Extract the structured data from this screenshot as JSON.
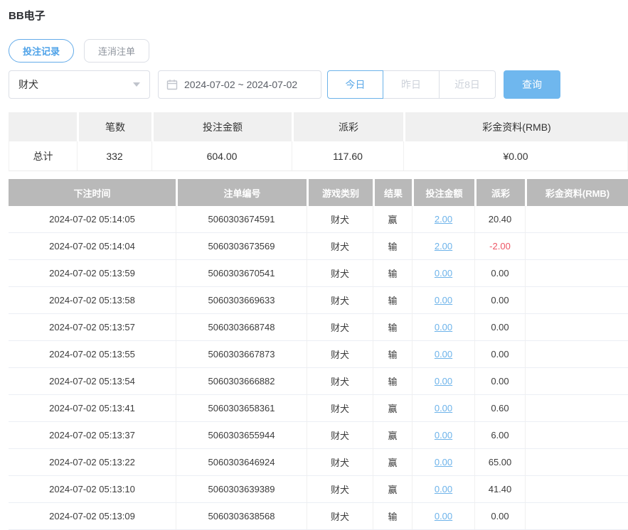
{
  "page": {
    "title": "BB电子"
  },
  "tabs": [
    {
      "label": "投注记录",
      "active": true
    },
    {
      "label": "连消注单",
      "active": false
    }
  ],
  "filters": {
    "game_select": {
      "value": "财犬",
      "caret_icon": "caret-down-icon"
    },
    "date_range": {
      "value": "2024-07-02 ~ 2024-07-02",
      "icon": "calendar-icon"
    },
    "quick_ranges": [
      {
        "label": "今日",
        "active": true
      },
      {
        "label": "昨日",
        "active": false
      },
      {
        "label": "近8日",
        "active": false
      }
    ],
    "search_label": "查询"
  },
  "summary": {
    "headers": [
      "",
      "笔数",
      "投注金额",
      "派彩",
      "彩金资料(RMB)"
    ],
    "row": {
      "label": "总计",
      "count": "332",
      "bet_amount": "604.00",
      "payout": "117.60",
      "bonus": "¥0.00"
    }
  },
  "table": {
    "headers": [
      "下注时间",
      "注单编号",
      "游戏类别",
      "结果",
      "投注金额",
      "派彩",
      "彩金资料(RMB)"
    ],
    "rows": [
      {
        "time": "2024-07-02 05:14:05",
        "order_no": "5060303674591",
        "game": "财犬",
        "result": "赢",
        "bet": "2.00",
        "payout": "20.40",
        "bonus": ""
      },
      {
        "time": "2024-07-02 05:14:04",
        "order_no": "5060303673569",
        "game": "财犬",
        "result": "输",
        "bet": "2.00",
        "payout": "-2.00",
        "bonus": ""
      },
      {
        "time": "2024-07-02 05:13:59",
        "order_no": "5060303670541",
        "game": "财犬",
        "result": "输",
        "bet": "0.00",
        "payout": "0.00",
        "bonus": ""
      },
      {
        "time": "2024-07-02 05:13:58",
        "order_no": "5060303669633",
        "game": "财犬",
        "result": "输",
        "bet": "0.00",
        "payout": "0.00",
        "bonus": ""
      },
      {
        "time": "2024-07-02 05:13:57",
        "order_no": "5060303668748",
        "game": "财犬",
        "result": "输",
        "bet": "0.00",
        "payout": "0.00",
        "bonus": ""
      },
      {
        "time": "2024-07-02 05:13:55",
        "order_no": "5060303667873",
        "game": "财犬",
        "result": "输",
        "bet": "0.00",
        "payout": "0.00",
        "bonus": ""
      },
      {
        "time": "2024-07-02 05:13:54",
        "order_no": "5060303666882",
        "game": "财犬",
        "result": "输",
        "bet": "0.00",
        "payout": "0.00",
        "bonus": ""
      },
      {
        "time": "2024-07-02 05:13:41",
        "order_no": "5060303658361",
        "game": "财犬",
        "result": "赢",
        "bet": "0.00",
        "payout": "0.60",
        "bonus": ""
      },
      {
        "time": "2024-07-02 05:13:37",
        "order_no": "5060303655944",
        "game": "财犬",
        "result": "赢",
        "bet": "0.00",
        "payout": "6.00",
        "bonus": ""
      },
      {
        "time": "2024-07-02 05:13:22",
        "order_no": "5060303646924",
        "game": "财犬",
        "result": "赢",
        "bet": "0.00",
        "payout": "65.00",
        "bonus": ""
      },
      {
        "time": "2024-07-02 05:13:10",
        "order_no": "5060303639389",
        "game": "财犬",
        "result": "赢",
        "bet": "0.00",
        "payout": "41.40",
        "bonus": ""
      },
      {
        "time": "2024-07-02 05:13:09",
        "order_no": "5060303638568",
        "game": "财犬",
        "result": "输",
        "bet": "0.00",
        "payout": "0.00",
        "bonus": ""
      }
    ]
  },
  "colors": {
    "accent_blue": "#6cb3e9",
    "primary_button_bg": "#6fb7ee",
    "link_blue": "#6db3ea",
    "negative_red": "#ed5565",
    "table_header_bg": "#b9b9b9",
    "summary_header_bg": "#f0f0f0"
  }
}
